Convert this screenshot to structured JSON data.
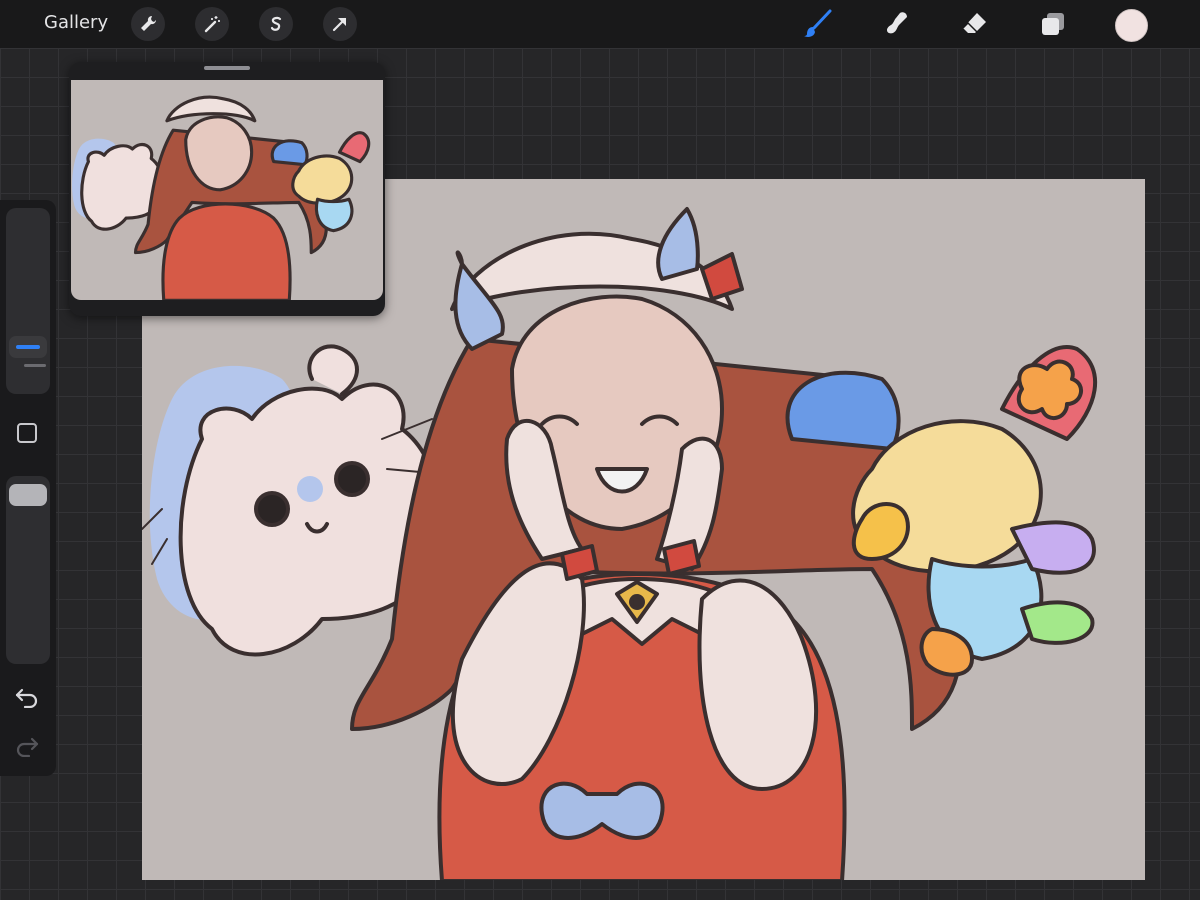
{
  "toolbar": {
    "gallery_label": "Gallery",
    "left_tools": [
      "wrench-icon",
      "magic-wand-icon",
      "selection-s-icon",
      "transform-arrow-icon"
    ],
    "right_tools": [
      "brush-icon",
      "smudge-icon",
      "eraser-icon",
      "layers-icon",
      "color-swatch"
    ],
    "active_tool": "brush",
    "accent_color": "#2f80f5",
    "current_color": "#f1e2e1"
  },
  "sidebar": {
    "brush_size_slider": "brush-size",
    "modify_button": "square-modify",
    "opacity_slider": "opacity",
    "undo": "undo-icon",
    "redo": "redo-icon"
  },
  "canvas": {
    "background_color": "#c0b9b7"
  },
  "reference_window": {
    "label": "reference"
  }
}
